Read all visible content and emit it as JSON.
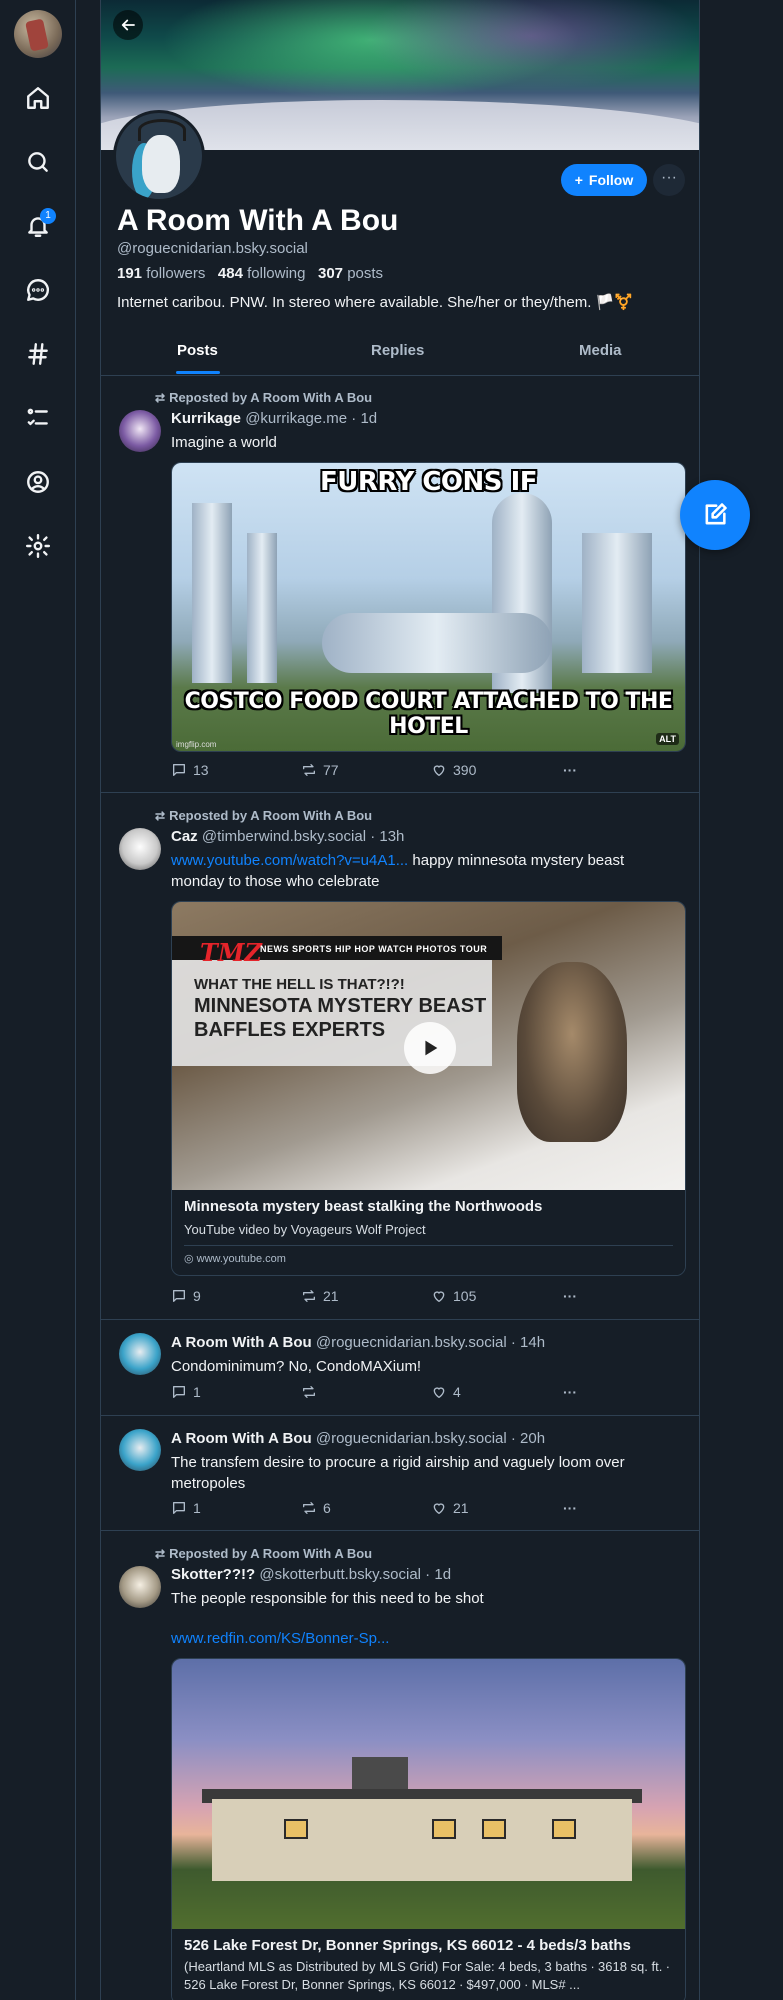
{
  "sidebar": {
    "notifications_badge": "1",
    "items": [
      {
        "icon": "home-icon"
      },
      {
        "icon": "search-icon"
      },
      {
        "icon": "bell-icon"
      },
      {
        "icon": "chat-icon"
      },
      {
        "icon": "hashtag-icon"
      },
      {
        "icon": "list-icon"
      },
      {
        "icon": "profile-icon"
      },
      {
        "icon": "gear-icon"
      }
    ]
  },
  "profile": {
    "display_name": "A Room With A Bou",
    "handle": "@roguecnidarian.bsky.social",
    "followers_count": "191",
    "followers_label": "followers",
    "following_count": "484",
    "following_label": "following",
    "posts_count": "307",
    "posts_label": "posts",
    "bio": "Internet caribou. PNW. In stereo where available. She/her or they/them. 🏳️⚧️",
    "follow_label": "Follow",
    "more_label": "···"
  },
  "tabs": [
    "Posts",
    "Replies",
    "Media"
  ],
  "posts": [
    {
      "repost_label": "Reposted by A Room With A Bou",
      "author": "Kurrikage",
      "handle": "@kurrikage.me · 1d",
      "text": "Imagine a world",
      "image_top_text": "FURRY CONS IF",
      "image_bottom_text": "COSTCO FOOD COURT ATTACHED TO THE HOTEL",
      "image_watermark": "imgflip.com",
      "alt_badge": "ALT",
      "replies": "13",
      "reposts": "77",
      "likes": "390"
    },
    {
      "repost_label": "Reposted by A Room With A Bou",
      "author": "Caz",
      "handle": "@timberwind.bsky.social · 13h",
      "link_text": "www.youtube.com/watch?v=u4A1...",
      "text": " happy minnesota mystery beast monday to those who celebrate",
      "video_logo": "TMZ",
      "video_nav": "NEWS   SPORTS   HIP HOP   WATCH   PHOTOS   TOUR",
      "video_line1": "WHAT THE HELL IS THAT?!?!",
      "video_line2": "MINNESOTA MYSTERY BEAST BAFFLES EXPERTS",
      "card_title": "Minnesota mystery beast stalking the Northwoods",
      "card_desc": "YouTube video by Voyageurs Wolf Project",
      "card_domain": "www.youtube.com",
      "replies": "9",
      "reposts": "21",
      "likes": "105"
    },
    {
      "author": "A Room With A Bou",
      "handle": "@roguecnidarian.bsky.social · 14h",
      "text": "Condominimum? No, CondoMAXium!",
      "replies": "1",
      "reposts": "",
      "likes": "4"
    },
    {
      "author": "A Room With A Bou",
      "handle": "@roguecnidarian.bsky.social · 20h",
      "text": "The transfem desire to procure a rigid airship and vaguely loom over metropoles",
      "replies": "1",
      "reposts": "6",
      "likes": "21"
    },
    {
      "repost_label": "Reposted by A Room With A Bou",
      "author": "Skotter??!?",
      "handle": "@skotterbutt.bsky.social · 1d",
      "text": "The people responsible for this need to be shot",
      "link_text": "www.redfin.com/KS/Bonner-Sp...",
      "card_title": "526 Lake Forest Dr, Bonner Springs, KS 66012 - 4 beds/3 baths",
      "card_desc": "(Heartland MLS as Distributed by MLS Grid) For Sale: 4 beds, 3 baths ∙ 3618 sq. ft. ∙ 526 Lake Forest Dr, Bonner Springs, KS 66012 ∙ $497,000 ∙ MLS# ..."
    }
  ]
}
